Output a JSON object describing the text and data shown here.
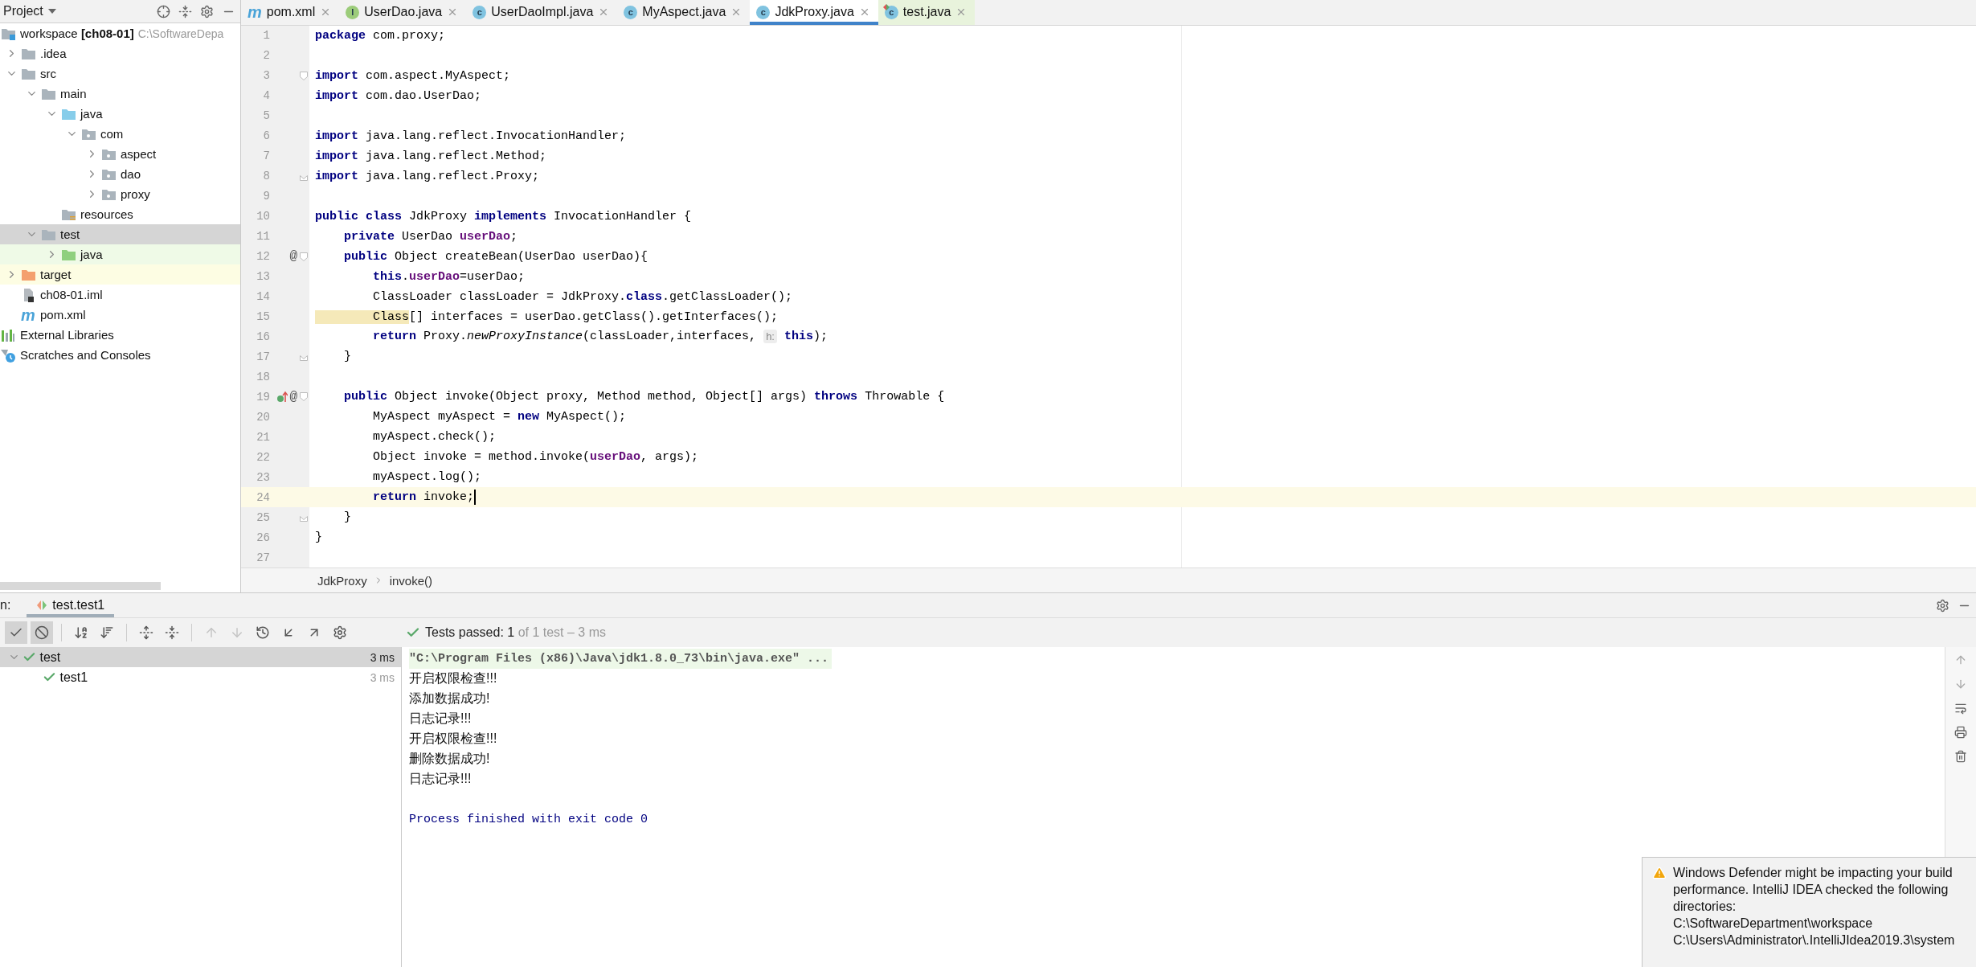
{
  "project_panel": {
    "title": "Project",
    "tree": [
      {
        "name": "workspace",
        "module": "[ch08-01]",
        "path": "C:\\SoftwareDepa",
        "kind": "module",
        "selected": false,
        "children": [
          {
            "name": ".idea",
            "kind": "folder",
            "expanded": false,
            "selected": false
          },
          {
            "name": "src",
            "kind": "folder",
            "expanded": true,
            "selected": false,
            "children": [
              {
                "name": "main",
                "kind": "folder",
                "expanded": true,
                "selected": false,
                "children": [
                  {
                    "name": "java",
                    "kind": "source",
                    "expanded": true,
                    "selected": false,
                    "children": [
                      {
                        "name": "com",
                        "kind": "package",
                        "expanded": true,
                        "selected": false,
                        "children": [
                          {
                            "name": "aspect",
                            "kind": "package",
                            "expanded": false,
                            "selected": false
                          },
                          {
                            "name": "dao",
                            "kind": "package",
                            "expanded": false,
                            "selected": false
                          },
                          {
                            "name": "proxy",
                            "kind": "package",
                            "expanded": false,
                            "selected": false
                          }
                        ]
                      }
                    ]
                  },
                  {
                    "name": "resources",
                    "kind": "resources",
                    "selected": false
                  }
                ]
              },
              {
                "name": "test",
                "kind": "folder",
                "expanded": true,
                "selected": true,
                "children": [
                  {
                    "name": "java",
                    "kind": "testsource",
                    "expanded": false,
                    "selected": false
                  }
                ]
              }
            ]
          },
          {
            "name": "target",
            "kind": "excluded",
            "expanded": false,
            "selected": false
          },
          {
            "name": "ch08-01.iml",
            "kind": "iml",
            "selected": false
          },
          {
            "name": "pom.xml",
            "kind": "maven",
            "badge": "m",
            "selected": false
          }
        ]
      },
      {
        "name": "External Libraries",
        "kind": "libraries",
        "selected": false
      },
      {
        "name": "Scratches and Consoles",
        "kind": "scratches",
        "selected": false
      }
    ]
  },
  "editor_tabs": [
    {
      "label": "pom.xml",
      "kind": "maven",
      "badge": "m",
      "selected": false
    },
    {
      "label": "UserDao.java",
      "kind": "interface",
      "badge": "I",
      "selected": false
    },
    {
      "label": "UserDaoImpl.java",
      "kind": "class",
      "badge": "c",
      "selected": false
    },
    {
      "label": "MyAspect.java",
      "kind": "class",
      "badge": "c",
      "selected": false
    },
    {
      "label": "JdkProxy.java",
      "kind": "class",
      "badge": "c",
      "selected": true
    },
    {
      "label": "test.java",
      "kind": "test",
      "badge": "c",
      "selected": false
    }
  ],
  "code": [
    {
      "number": "1",
      "current": false,
      "tokens": [
        {
          "kind": "keyword",
          "text": "package"
        },
        {
          "kind": "plain",
          "text": " com.proxy;"
        }
      ]
    },
    {
      "number": "2",
      "current": false
    },
    {
      "number": "3",
      "current": false,
      "gutter": [
        {
          "kind": "fold-start"
        }
      ],
      "tokens": [
        {
          "kind": "keyword",
          "text": "import"
        },
        {
          "kind": "plain",
          "text": " com.aspect.MyAspect;"
        }
      ]
    },
    {
      "number": "4",
      "current": false,
      "tokens": [
        {
          "kind": "keyword",
          "text": "import"
        },
        {
          "kind": "plain",
          "text": " com.dao.UserDao;"
        }
      ]
    },
    {
      "number": "5",
      "current": false
    },
    {
      "number": "6",
      "current": false,
      "tokens": [
        {
          "kind": "keyword",
          "text": "import"
        },
        {
          "kind": "plain",
          "text": " java.lang.reflect.InvocationHandler;"
        }
      ]
    },
    {
      "number": "7",
      "current": false,
      "tokens": [
        {
          "kind": "keyword",
          "text": "import"
        },
        {
          "kind": "plain",
          "text": " java.lang.reflect.Method;"
        }
      ]
    },
    {
      "number": "8",
      "current": false,
      "gutter": [
        {
          "kind": "fold-end"
        }
      ],
      "tokens": [
        {
          "kind": "keyword",
          "text": "import"
        },
        {
          "kind": "plain",
          "text": " java.lang.reflect.Proxy;"
        }
      ]
    },
    {
      "number": "9",
      "current": false
    },
    {
      "number": "10",
      "current": false,
      "tokens": [
        {
          "kind": "keyword",
          "text": "public class"
        },
        {
          "kind": "plain",
          "text": " JdkProxy "
        },
        {
          "kind": "keyword",
          "text": "implements"
        },
        {
          "kind": "plain",
          "text": " InvocationHandler {"
        }
      ]
    },
    {
      "number": "11",
      "current": false,
      "tokens": [
        {
          "kind": "keyword",
          "text": "    private"
        },
        {
          "kind": "plain",
          "text": " UserDao "
        },
        {
          "kind": "field",
          "text": "userDao"
        },
        {
          "kind": "plain",
          "text": ";"
        }
      ]
    },
    {
      "number": "12",
      "current": false,
      "gutter": [
        {
          "kind": "annotation",
          "text": "@"
        },
        {
          "kind": "fold-start"
        }
      ],
      "tokens": [
        {
          "kind": "keyword",
          "text": "    public"
        },
        {
          "kind": "plain",
          "text": " Object createBean(UserDao userDao){"
        }
      ]
    },
    {
      "number": "13",
      "current": false,
      "tokens": [
        {
          "kind": "keyword",
          "text": "        this"
        },
        {
          "kind": "plain",
          "text": "."
        },
        {
          "kind": "field",
          "text": "userDao"
        },
        {
          "kind": "plain",
          "text": "=userDao;"
        }
      ]
    },
    {
      "number": "14",
      "current": false,
      "tokens": [
        {
          "kind": "plain",
          "text": "        ClassLoader classLoader = JdkProxy."
        },
        {
          "kind": "keyword",
          "text": "class"
        },
        {
          "kind": "plain",
          "text": ".getClassLoader();"
        }
      ]
    },
    {
      "number": "15",
      "current": false,
      "tokens": [
        {
          "kind": "marked",
          "text": "        Class"
        },
        {
          "kind": "plain",
          "text": "[] interfaces = userDao.getClass().getInterfaces();"
        }
      ]
    },
    {
      "number": "16",
      "current": false,
      "tokens": [
        {
          "kind": "keyword",
          "text": "        return"
        },
        {
          "kind": "plain",
          "text": " Proxy."
        },
        {
          "kind": "static",
          "text": "newProxyInstance"
        },
        {
          "kind": "plain",
          "text": "(classLoader,interfaces, "
        },
        {
          "kind": "hint",
          "text": "h:"
        },
        {
          "kind": "keyword",
          "text": " this"
        },
        {
          "kind": "plain",
          "text": ");"
        }
      ]
    },
    {
      "number": "17",
      "current": false,
      "gutter": [
        {
          "kind": "fold-end"
        }
      ],
      "tokens": [
        {
          "kind": "plain",
          "text": "    }"
        }
      ]
    },
    {
      "number": "18",
      "current": false
    },
    {
      "number": "19",
      "current": false,
      "gutter": [
        {
          "kind": "implements"
        },
        {
          "kind": "annotation",
          "text": "@"
        },
        {
          "kind": "fold-start"
        }
      ],
      "tokens": [
        {
          "kind": "keyword",
          "text": "    public"
        },
        {
          "kind": "plain",
          "text": " Object invoke(Object proxy, Method method, Object[] args) "
        },
        {
          "kind": "keyword",
          "text": "throws"
        },
        {
          "kind": "plain",
          "text": " Throwable {"
        }
      ]
    },
    {
      "number": "20",
      "current": false,
      "tokens": [
        {
          "kind": "plain",
          "text": "        MyAspect myAspect = "
        },
        {
          "kind": "keyword",
          "text": "new"
        },
        {
          "kind": "plain",
          "text": " MyAspect();"
        }
      ]
    },
    {
      "number": "21",
      "current": false,
      "tokens": [
        {
          "kind": "plain",
          "text": "        myAspect.check();"
        }
      ]
    },
    {
      "number": "22",
      "current": false,
      "tokens": [
        {
          "kind": "plain",
          "text": "        Object invoke = method.invoke("
        },
        {
          "kind": "field",
          "text": "userDao"
        },
        {
          "kind": "plain",
          "text": ", args);"
        }
      ]
    },
    {
      "number": "23",
      "current": false,
      "tokens": [
        {
          "kind": "plain",
          "text": "        myAspect.log();"
        }
      ]
    },
    {
      "number": "24",
      "current": true,
      "tokens": [
        {
          "kind": "keyword",
          "text": "        return"
        },
        {
          "kind": "plain",
          "text": " invoke;"
        }
      ]
    },
    {
      "number": "25",
      "current": false,
      "gutter": [
        {
          "kind": "fold-end"
        }
      ],
      "tokens": [
        {
          "kind": "plain",
          "text": "    }"
        }
      ]
    },
    {
      "number": "26",
      "current": false,
      "tokens": [
        {
          "kind": "plain",
          "text": "}"
        }
      ]
    },
    {
      "number": "27",
      "current": false
    }
  ],
  "breadcrumbs": [
    "JdkProxy",
    "invoke()"
  ],
  "run_panel": {
    "label": "n:",
    "tabs": [
      {
        "label": "test.test1",
        "selected": true
      }
    ],
    "toolbar": [
      [
        {
          "kind": "show-passed",
          "toggled": true,
          "disabled": false
        },
        {
          "kind": "show-ignored",
          "toggled": true,
          "disabled": false
        }
      ],
      [
        {
          "kind": "sort-alpha",
          "toggled": false,
          "disabled": false
        },
        {
          "kind": "sort-duration",
          "toggled": false,
          "disabled": false
        }
      ],
      [
        {
          "kind": "expand-all",
          "toggled": false,
          "disabled": false
        },
        {
          "kind": "collapse-all",
          "toggled": false,
          "disabled": false
        }
      ],
      [
        {
          "kind": "previous",
          "toggled": false,
          "disabled": true
        },
        {
          "kind": "next",
          "toggled": false,
          "disabled": true
        },
        {
          "kind": "history",
          "toggled": false,
          "disabled": false
        },
        {
          "kind": "import",
          "toggled": false,
          "disabled": false
        },
        {
          "kind": "export",
          "toggled": false,
          "disabled": false
        },
        {
          "kind": "settings",
          "toggled": false,
          "disabled": false
        }
      ]
    ],
    "status": {
      "passed": "Tests passed: 1",
      "detail": "of 1 test – 3 ms"
    },
    "tests": [
      {
        "name": "test",
        "time": "3 ms",
        "passed": true,
        "expanded": true,
        "selected": true,
        "children": [
          {
            "name": "test1",
            "time": "3 ms",
            "passed": true,
            "selected": false
          }
        ]
      }
    ],
    "console": [
      {
        "kind": "command",
        "text": "\"C:\\Program Files (x86)\\Java\\jdk1.8.0_73\\bin\\java.exe\" ..."
      },
      {
        "kind": "output",
        "text": "开启权限检查!!!"
      },
      {
        "kind": "output",
        "text": "添加数据成功!"
      },
      {
        "kind": "output",
        "text": "日志记录!!!"
      },
      {
        "kind": "output",
        "text": "开启权限检查!!!"
      },
      {
        "kind": "output",
        "text": "删除数据成功!"
      },
      {
        "kind": "output",
        "text": "日志记录!!!"
      },
      {
        "kind": "system",
        "text": "Process finished with exit code 0"
      }
    ]
  },
  "notification": {
    "kind": "warning",
    "message": "Windows Defender might be impacting your build performance. IntelliJ IDEA checked the following directories:",
    "paths": [
      "C:\\SoftwareDepartment\\workspace",
      "C:\\Users\\Administrator\\.IntelliJIdea2019.3\\system"
    ]
  }
}
